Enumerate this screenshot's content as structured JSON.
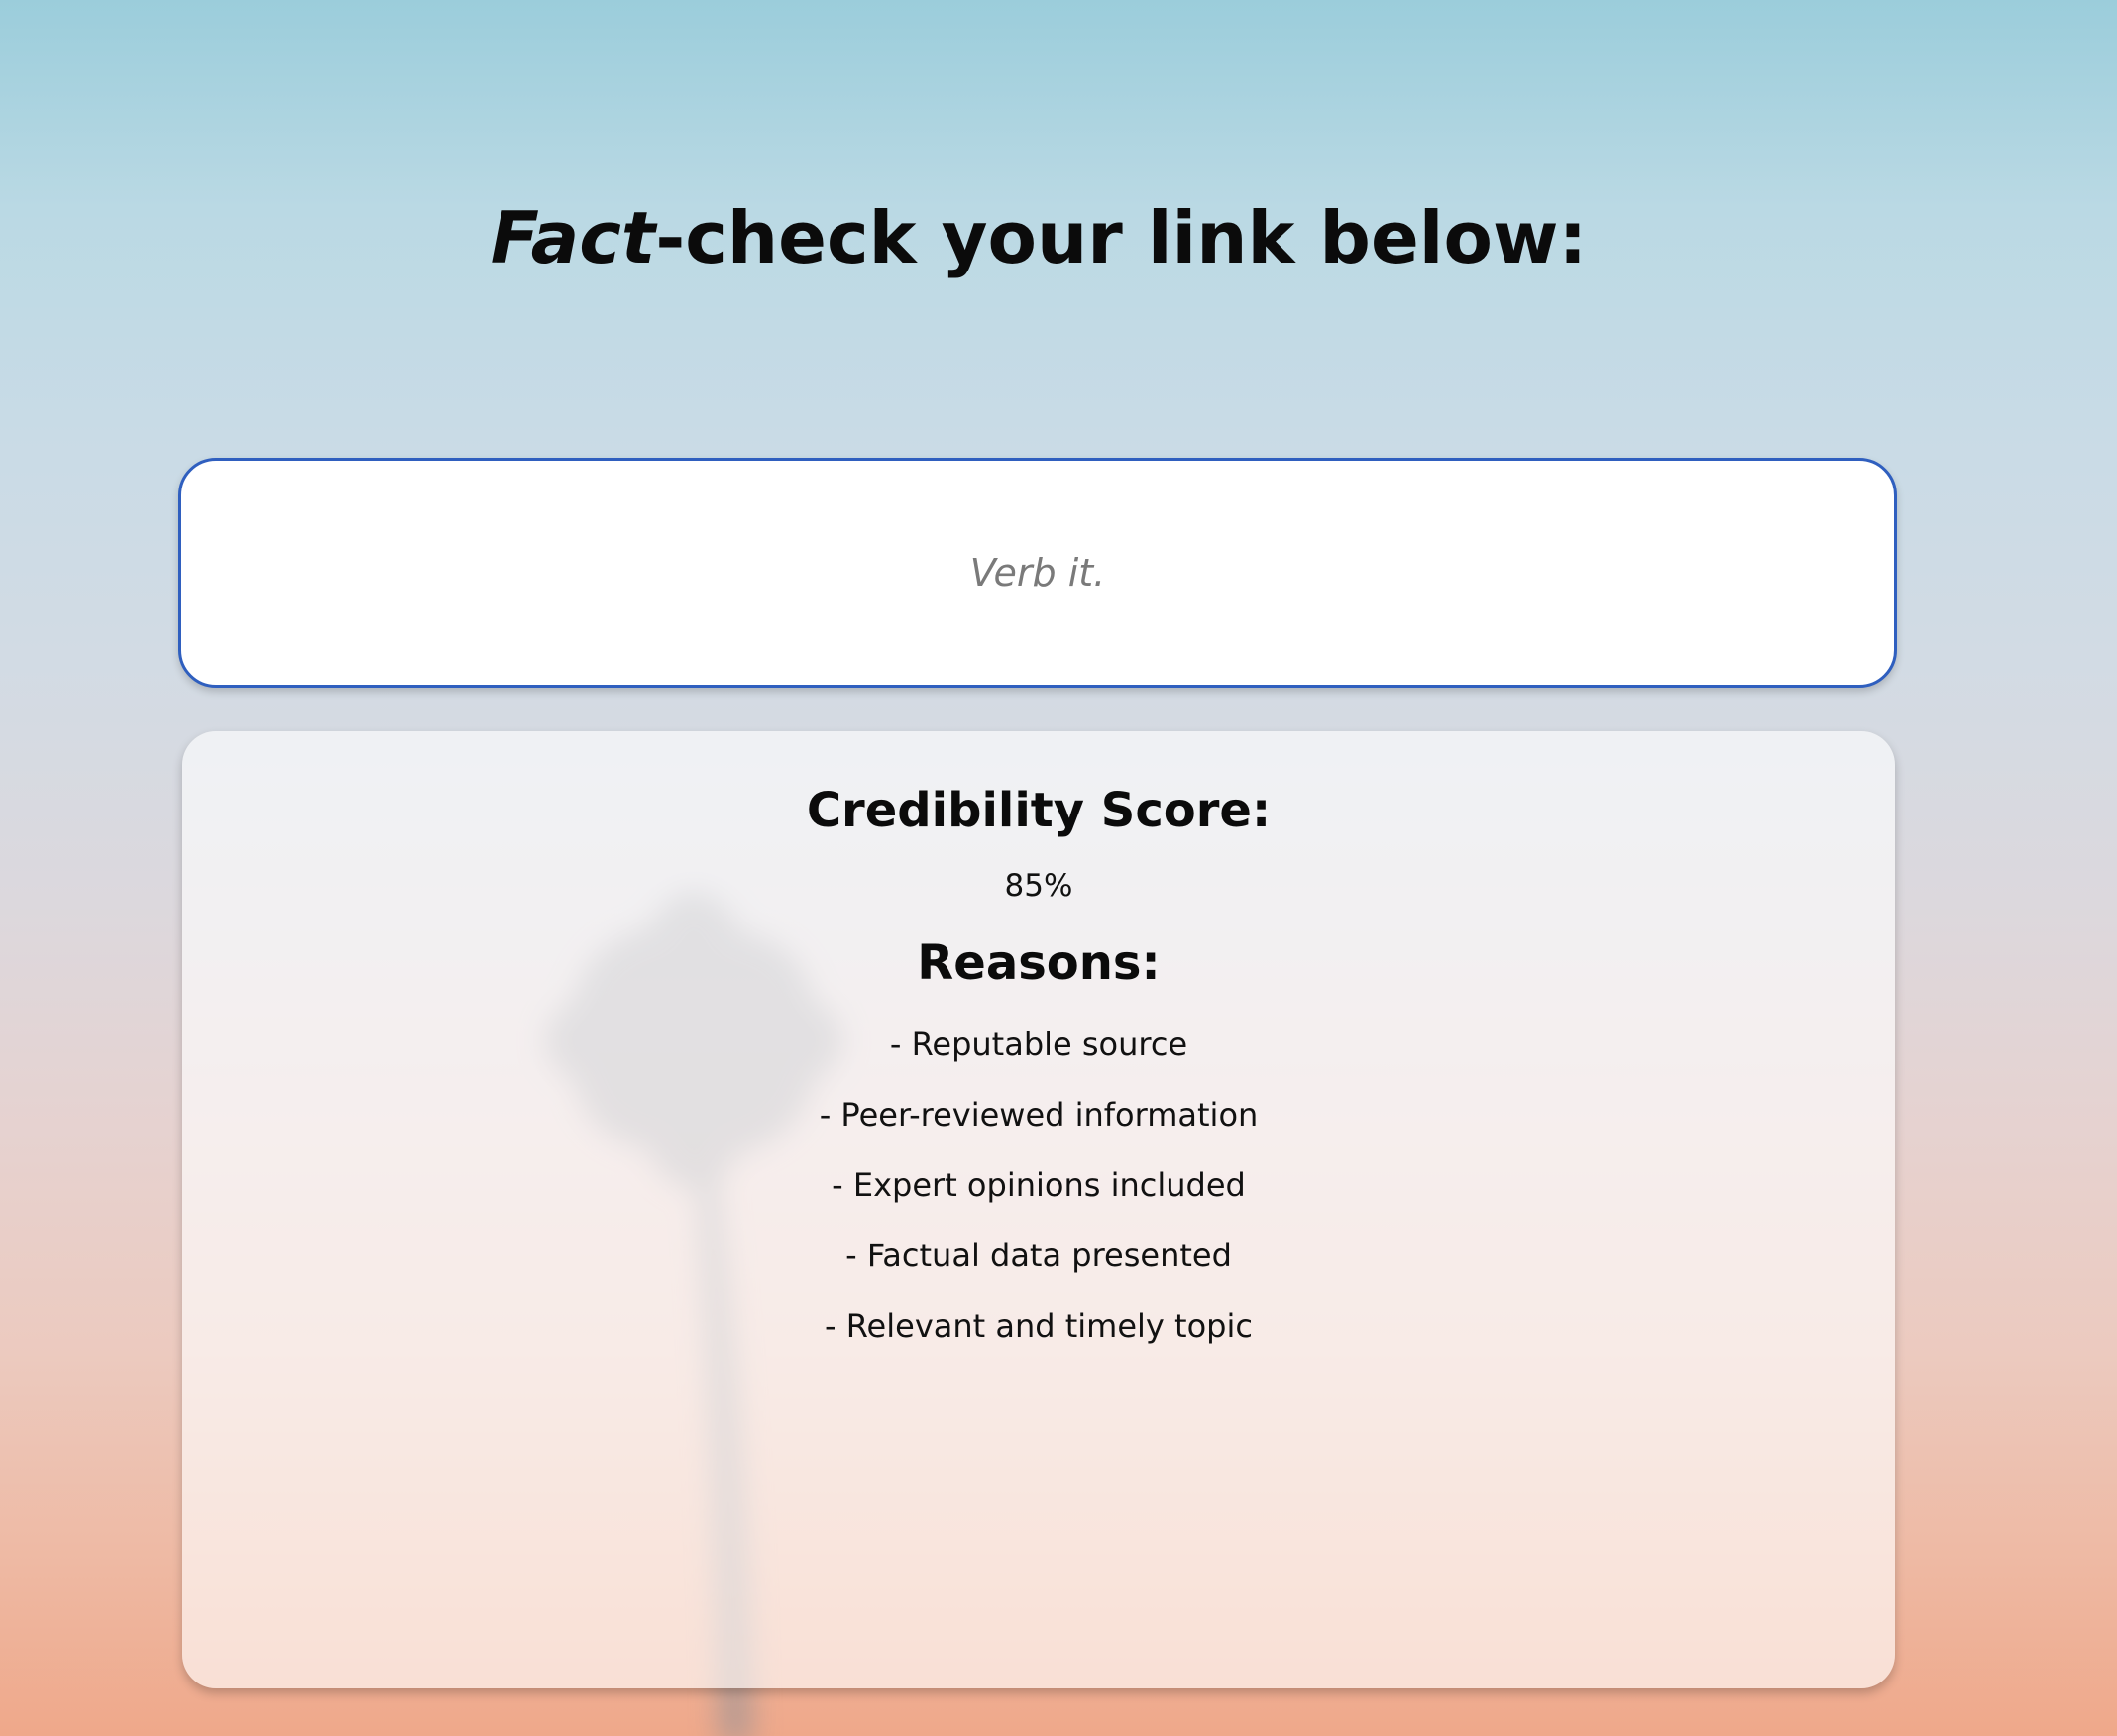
{
  "header": {
    "title_emphasis": "Fact",
    "title_rest": "-check your link below:"
  },
  "input": {
    "placeholder": "Verb it.",
    "value": ""
  },
  "result": {
    "score_heading": "Credibility Score:",
    "score_value": "85%",
    "reasons_heading": "Reasons:",
    "reasons": [
      "- Reputable source",
      "- Peer-reviewed information",
      "- Expert opinions included",
      "- Factual data presented",
      "- Relevant and timely topic"
    ]
  },
  "colors": {
    "input_border": "#2f5fbf",
    "background_top": "#9bcddb",
    "background_bottom": "#efa88a"
  }
}
